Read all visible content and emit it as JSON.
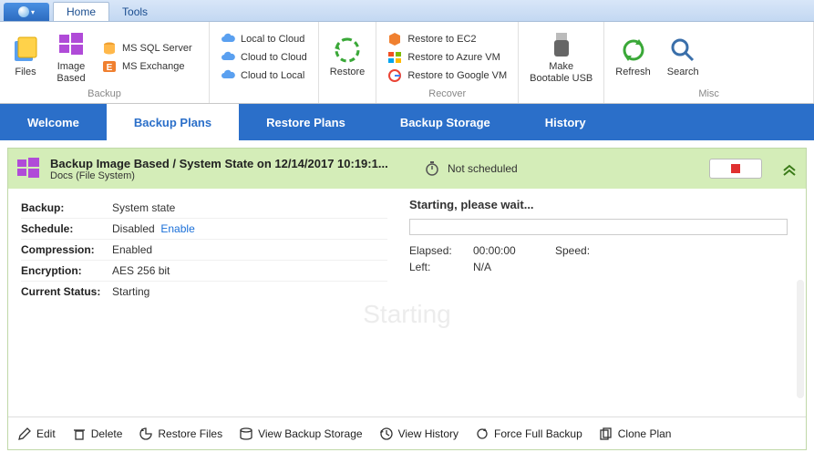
{
  "menu": {
    "tabs": [
      "Home",
      "Tools"
    ],
    "active": 0
  },
  "ribbon": {
    "groups": [
      {
        "label": "Backup",
        "big": [
          {
            "name": "files",
            "label": "Files",
            "icon": "files-icon"
          },
          {
            "name": "image-based",
            "label": "Image\nBased",
            "icon": "windows-icon"
          }
        ],
        "small": [
          {
            "name": "ms-sql",
            "label": "MS SQL Server",
            "icon": "db-icon"
          },
          {
            "name": "ms-exchange",
            "label": "MS Exchange",
            "icon": "exchange-icon"
          }
        ]
      },
      {
        "label": "",
        "small": [
          {
            "name": "local-to-cloud",
            "label": "Local to Cloud",
            "icon": "cloud-up-icon"
          },
          {
            "name": "cloud-to-cloud",
            "label": "Cloud to Cloud",
            "icon": "cloud-sync-icon"
          },
          {
            "name": "cloud-to-local",
            "label": "Cloud to Local",
            "icon": "cloud-down-icon"
          }
        ]
      },
      {
        "label": "",
        "big": [
          {
            "name": "restore",
            "label": "Restore",
            "icon": "restore-icon"
          }
        ]
      },
      {
        "label": "Recover",
        "small": [
          {
            "name": "restore-ec2",
            "label": "Restore to EC2",
            "icon": "ec2-icon"
          },
          {
            "name": "restore-azure",
            "label": "Restore to Azure VM",
            "icon": "azure-icon"
          },
          {
            "name": "restore-google",
            "label": "Restore to Google VM",
            "icon": "google-icon"
          }
        ]
      },
      {
        "label": "",
        "big": [
          {
            "name": "bootable-usb",
            "label": "Make\nBootable USB",
            "icon": "usb-icon"
          }
        ]
      },
      {
        "label": "Misc",
        "big": [
          {
            "name": "refresh",
            "label": "Refresh",
            "icon": "refresh-icon"
          },
          {
            "name": "search",
            "label": "Search",
            "icon": "search-icon"
          }
        ]
      }
    ]
  },
  "nav": {
    "tabs": [
      "Welcome",
      "Backup Plans",
      "Restore Plans",
      "Backup Storage",
      "History"
    ],
    "active": 1
  },
  "plan": {
    "title": "Backup Image Based / System State on 12/14/2017 10:19:1...",
    "subtitle": "Docs (File System)",
    "schedule_status": "Not scheduled",
    "props": {
      "backup": {
        "k": "Backup:",
        "v": "System state"
      },
      "schedule": {
        "k": "Schedule:",
        "v": "Disabled",
        "link": "Enable"
      },
      "compression": {
        "k": "Compression:",
        "v": "Enabled"
      },
      "encryption": {
        "k": "Encryption:",
        "v": "AES 256 bit"
      },
      "status": {
        "k": "Current Status:",
        "v": "Starting"
      }
    },
    "progress": {
      "heading": "Starting, please wait...",
      "elapsed_k": "Elapsed:",
      "elapsed_v": "00:00:00",
      "left_k": "Left:",
      "left_v": "N/A",
      "speed_k": "Speed:",
      "speed_v": ""
    },
    "watermark": "Starting"
  },
  "actions": {
    "edit": "Edit",
    "delete": "Delete",
    "restore_files": "Restore Files",
    "view_storage": "View Backup Storage",
    "view_history": "View History",
    "force_full": "Force Full Backup",
    "clone": "Clone Plan"
  }
}
